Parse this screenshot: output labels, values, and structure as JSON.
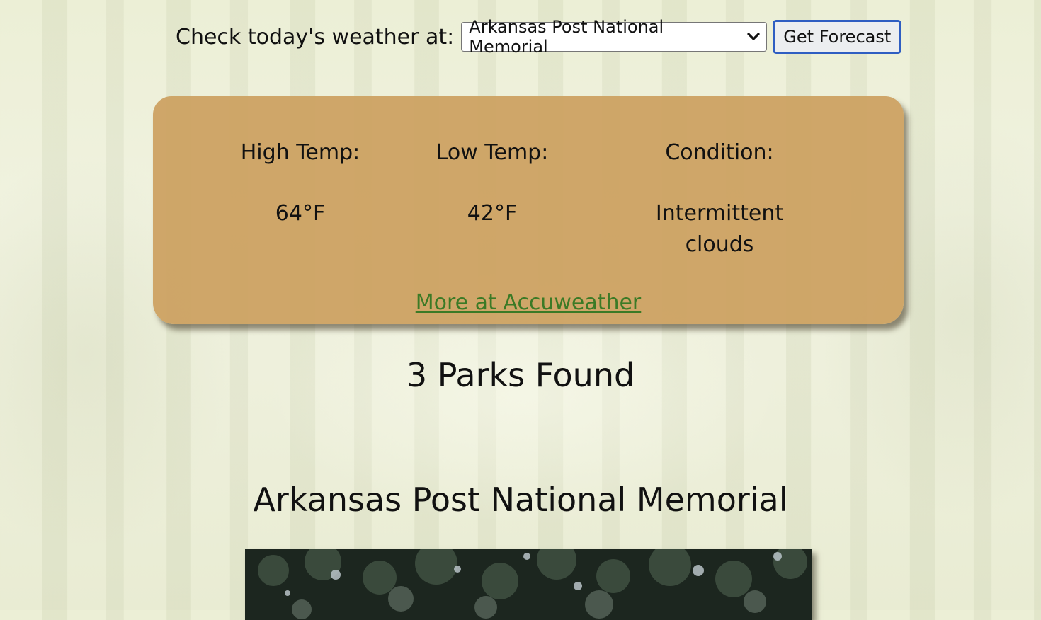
{
  "weather_form": {
    "label": "Check today's weather at:",
    "selected_park": "Arkansas Post National Memorial",
    "button_label": "Get Forecast"
  },
  "weather": {
    "high_label": "High Temp:",
    "high_value": "64°F",
    "low_label": "Low Temp:",
    "low_value": "42°F",
    "condition_label": "Condition:",
    "condition_value_line1": "Intermittent",
    "condition_value_line2": "clouds",
    "more_link": "More at Accuweather"
  },
  "results": {
    "count_text": "3 Parks Found"
  },
  "park": {
    "name": "Arkansas Post National Memorial"
  },
  "colors": {
    "card": "#cca060",
    "link": "#3b7a26",
    "button_border": "#2f5ec2"
  }
}
